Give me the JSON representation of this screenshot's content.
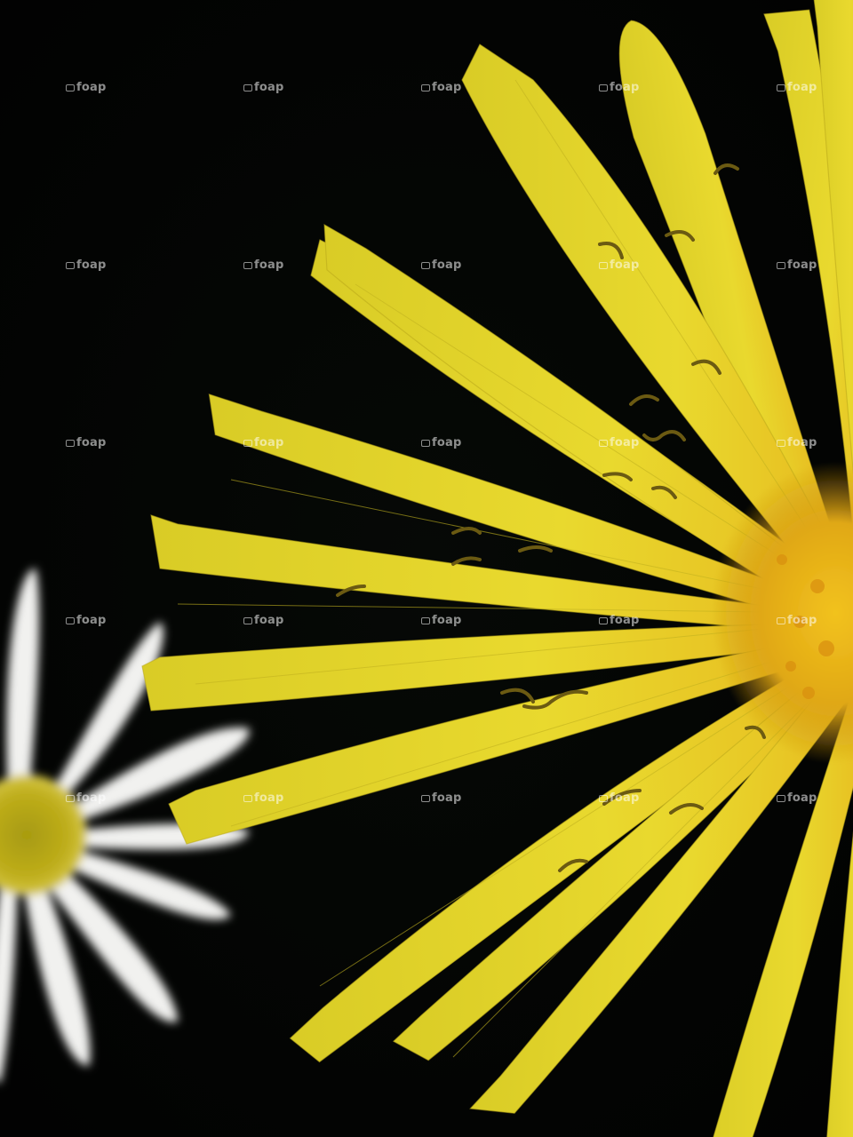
{
  "photo": {
    "background_color": "#020302",
    "subjects": {
      "dandelion": {
        "petal_color": "#e6d62a",
        "center_color": "#e3b41a"
      },
      "daisy": {
        "petal_color": "#f4f4f2",
        "center_color": "#b5a518"
      }
    }
  },
  "watermark": {
    "text": "foap",
    "icon": "camera-icon",
    "color": "#ffffff"
  }
}
